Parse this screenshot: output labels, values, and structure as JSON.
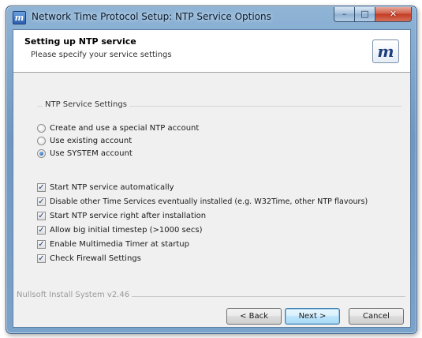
{
  "window": {
    "title": "Network Time Protocol Setup: NTP Service Options",
    "app_icon": "nsis-m-icon",
    "controls": {
      "minimize": "–",
      "maximize": "□",
      "close": "✕"
    }
  },
  "header": {
    "title": "Setting up NTP service",
    "subtitle": "Please specify your service settings",
    "logo_glyph": "m"
  },
  "group": {
    "title": "NTP Service Settings",
    "radios": [
      {
        "label": "Create and use a special NTP account",
        "checked": false
      },
      {
        "label": "Use existing account",
        "checked": false
      },
      {
        "label": "Use SYSTEM account",
        "checked": true
      }
    ],
    "checkboxes": [
      {
        "label": "Start NTP service automatically",
        "checked": true
      },
      {
        "label": "Disable other Time Services eventually installed (e.g. W32Time, other NTP flavours)",
        "checked": true
      },
      {
        "label": "Start NTP service right after installation",
        "checked": true
      },
      {
        "label": "Allow big initial timestep (>1000 secs)",
        "checked": true
      },
      {
        "label": "Enable Multimedia Timer at startup",
        "checked": true
      },
      {
        "label": "Check Firewall Settings",
        "checked": true
      }
    ]
  },
  "footer": {
    "brand": "Nullsoft Install System v2.46",
    "back_label": "< Back",
    "next_label": "Next >",
    "cancel_label": "Cancel"
  },
  "colors": {
    "accent": "#1b3f7d",
    "titlebar": "#7aa3cb",
    "close": "#c23b22"
  }
}
